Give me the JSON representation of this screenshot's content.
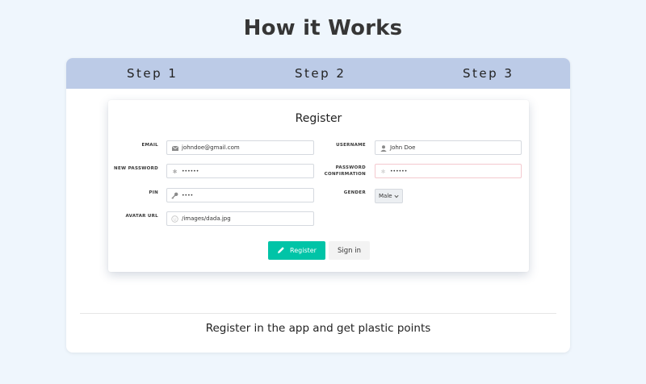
{
  "page": {
    "title": "How it Works"
  },
  "tabs": [
    {
      "label": "Step 1"
    },
    {
      "label": "Step 2"
    },
    {
      "label": "Step 3"
    }
  ],
  "form": {
    "title": "Register",
    "fields": {
      "email": {
        "label": "EMAIL",
        "value": "johndoe@gmail.com",
        "icon": "envelope-icon"
      },
      "username": {
        "label": "USERNAME",
        "value": "John Doe",
        "icon": "user-icon"
      },
      "new_password": {
        "label": "NEW PASSWORD",
        "value": "••••••",
        "icon": "asterisk-icon"
      },
      "password_confirmation": {
        "label_line1": "PASSWORD",
        "label_line2": "CONFIRMATION",
        "value": "••••••",
        "icon": "asterisk-icon"
      },
      "pin": {
        "label": "PIN",
        "value": "••••",
        "icon": "key-icon"
      },
      "gender": {
        "label": "GENDER",
        "selected": "Male"
      },
      "avatar_url": {
        "label": "AVATAR URL",
        "value": "/images/dada.jpg",
        "icon": "smiley-icon"
      }
    },
    "register_button": "Register",
    "signin_button": "Sign in"
  },
  "caption": "Register in the app and get plastic points",
  "colors": {
    "background": "#eff6fd",
    "tab_bar": "#bccbe7",
    "primary": "#00c4a7",
    "warn_border": "#f3c9cf"
  }
}
